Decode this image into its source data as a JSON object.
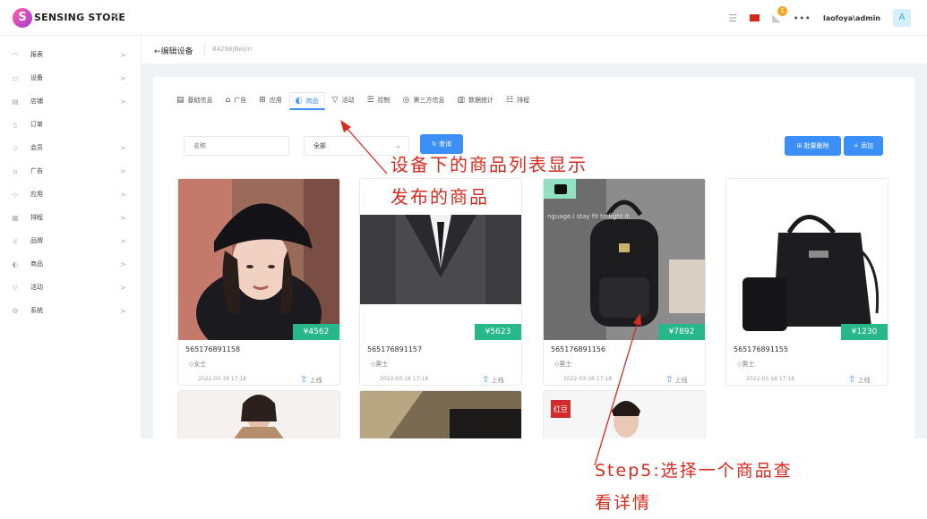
{
  "header": {
    "brand": "SENSING STORE",
    "logo_letter": "S",
    "collapse_glyph": "<",
    "notification_count": "1",
    "more_glyph": "•••",
    "user": "laofoya\\admin",
    "avatar_letter": "A"
  },
  "sidebar": {
    "items": [
      {
        "label": "报表",
        "icon": "dashboard-icon",
        "arrow": ">"
      },
      {
        "label": "设备",
        "icon": "device-icon",
        "arrow": ">"
      },
      {
        "label": "店铺",
        "icon": "store-icon",
        "arrow": ">"
      },
      {
        "label": "订单",
        "icon": "order-icon",
        "arrow": ""
      },
      {
        "label": "会员",
        "icon": "member-icon",
        "arrow": ">"
      },
      {
        "label": "广告",
        "icon": "ad-icon",
        "arrow": ">"
      },
      {
        "label": "应用",
        "icon": "app-icon",
        "arrow": ">"
      },
      {
        "label": "排程",
        "icon": "schedule-icon",
        "arrow": ">"
      },
      {
        "label": "品牌",
        "icon": "brand-icon",
        "arrow": ">"
      },
      {
        "label": "商品",
        "icon": "product-icon",
        "arrow": ">"
      },
      {
        "label": "活动",
        "icon": "activity-icon",
        "arrow": ">"
      },
      {
        "label": "系统",
        "icon": "system-icon",
        "arrow": ">"
      }
    ]
  },
  "breadcrumb": {
    "back": "←编辑设备",
    "device": "84298|Beijin"
  },
  "tabs": [
    {
      "label": "基础信息",
      "icon": "info-icon"
    },
    {
      "label": "广告",
      "icon": "ad-icon"
    },
    {
      "label": "应用",
      "icon": "app-icon"
    },
    {
      "label": "商品",
      "icon": "product-icon",
      "active": true
    },
    {
      "label": "活动",
      "icon": "activity-icon"
    },
    {
      "label": "控制",
      "icon": "control-icon"
    },
    {
      "label": "第三方信息",
      "icon": "third-party-icon"
    },
    {
      "label": "数据统计",
      "icon": "stats-icon"
    },
    {
      "label": "排程",
      "icon": "schedule-icon"
    }
  ],
  "filters": {
    "name_placeholder": "名称",
    "category_value": "全部",
    "query_label": "查询",
    "batch_delete_label": "批量删除",
    "add_label": "添加"
  },
  "products": [
    {
      "price": "¥4562",
      "sku": "565176891158",
      "tag": "女士",
      "date": "2022-03-18 17:18",
      "status": "上线"
    },
    {
      "price": "¥5623",
      "sku": "565176891157",
      "tag": "男士",
      "date": "2022-03-18 17:18",
      "status": "上线"
    },
    {
      "price": "¥7892",
      "sku": "565176891156",
      "tag": "男士",
      "date": "2022-03-18 17:18",
      "status": "上线"
    },
    {
      "price": "¥1230",
      "sku": "565176891155",
      "tag": "男士",
      "date": "2022-03-18 17:18",
      "status": "上线"
    }
  ],
  "partial_product_label": "红豆",
  "bag_image_text": "nguage.i stay fit to fight it.",
  "annotations": {
    "note1_line1": "设备下的商品列表显示",
    "note1_line2": "发布的商品",
    "note2_line1": "Step5:选择一个商品查",
    "note2_line2": "看详情"
  },
  "colors": {
    "primary": "#3b8ff7",
    "price_badge": "#27b88a",
    "annotation": "#d62b1f"
  }
}
